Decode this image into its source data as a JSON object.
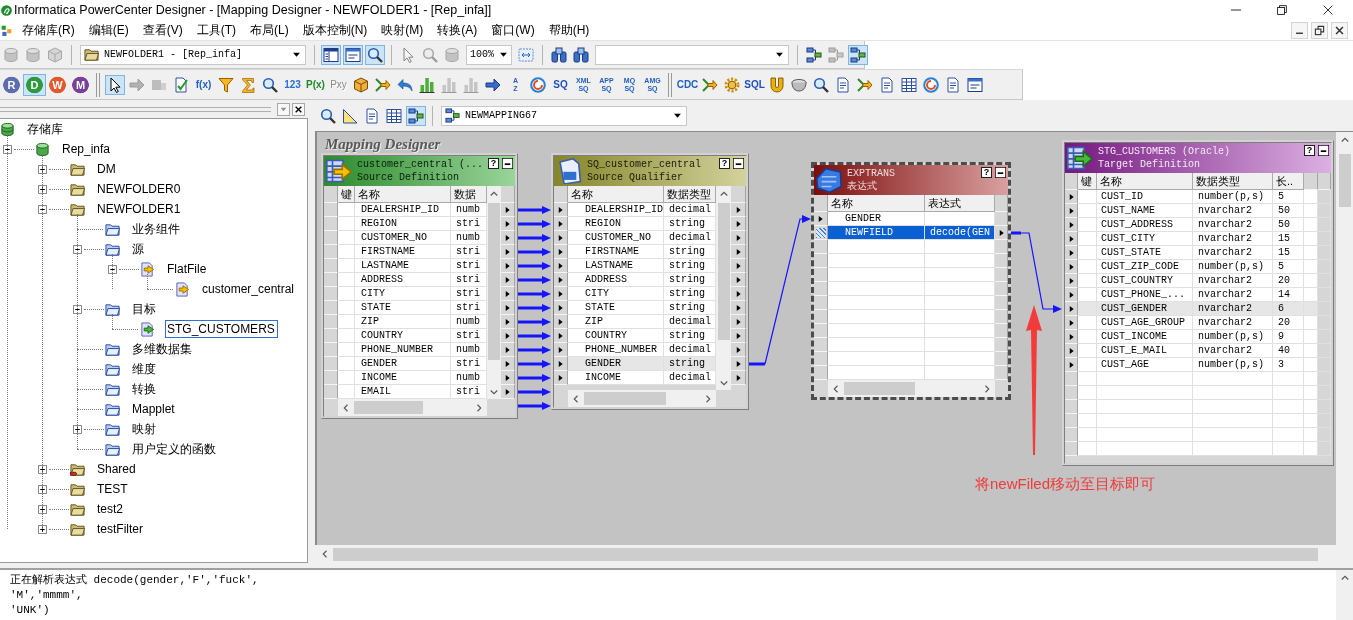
{
  "window": {
    "title": "Informatica PowerCenter Designer - [Mapping Designer - NEWFOLDER1 - [Rep_infa]]"
  },
  "menu": [
    "存储库(R)",
    "编辑(E)",
    "查看(V)",
    "工具(T)",
    "布局(L)",
    "版本控制(N)",
    "映射(M)",
    "转换(A)",
    "窗口(W)",
    "帮助(H)"
  ],
  "toolbar_1": [
    [
      {
        "kind": "cylinder",
        "pressed": false,
        "disabled": true
      },
      {
        "kind": "cylinder",
        "pressed": false,
        "disabled": true
      },
      {
        "kind": "cube",
        "pressed": false,
        "disabled": true
      }
    ],
    [
      {
        "kind": "folder-combo",
        "value": "NEWFOLDER1 - [Rep_infa]"
      }
    ],
    [
      {
        "kind": "panel",
        "pressed": true,
        "disabled": false
      },
      {
        "kind": "window",
        "pressed": true,
        "disabled": false
      },
      {
        "kind": "magnifier",
        "pressed": true,
        "disabled": false
      }
    ],
    [
      {
        "kind": "pointer",
        "pressed": false,
        "disabled": true
      },
      {
        "kind": "magnifier",
        "pressed": false,
        "disabled": true
      },
      {
        "kind": "cylinder",
        "pressed": false,
        "disabled": true
      },
      {
        "kind": "zoom-combo",
        "value": "100%"
      },
      {
        "kind": "fit",
        "pressed": false,
        "disabled": false
      }
    ],
    [
      {
        "kind": "binoculars",
        "pressed": false,
        "disabled": false
      },
      {
        "kind": "binoculars",
        "pressed": false,
        "disabled": false
      },
      {
        "kind": "dropdown"
      }
    ],
    [
      {
        "kind": "flow",
        "pressed": false,
        "disabled": false
      },
      {
        "kind": "flow",
        "pressed": false,
        "disabled": true
      },
      {
        "kind": "flow",
        "pressed": true,
        "disabled": false
      }
    ]
  ],
  "toolbar_2": [
    [
      {
        "kind": "letter",
        "label": "R",
        "color": "#5b6eb0",
        "pressed": false,
        "disabled": false
      },
      {
        "kind": "letter",
        "label": "D",
        "color": "#2f9a3c",
        "pressed": true,
        "disabled": false
      },
      {
        "kind": "letter",
        "label": "W",
        "color": "#e2572b",
        "pressed": false,
        "disabled": false
      },
      {
        "kind": "letter",
        "label": "M",
        "color": "#7a3f96",
        "pressed": false,
        "disabled": false
      }
    ],
    [
      {
        "kind": "pointer",
        "pressed": true,
        "disabled": false
      },
      {
        "kind": "arrow",
        "pressed": false,
        "disabled": true
      },
      {
        "kind": "blocks",
        "pressed": false,
        "disabled": true
      },
      {
        "kind": "check-doc",
        "pressed": false,
        "disabled": false
      },
      {
        "kind": "label",
        "label": "f(x)",
        "color": "#1f5fc8",
        "pressed": false,
        "disabled": false
      },
      {
        "kind": "funnel",
        "pressed": false,
        "disabled": false
      },
      {
        "kind": "sigma",
        "pressed": false,
        "disabled": false
      },
      {
        "kind": "magnifier",
        "pressed": false,
        "disabled": false
      },
      {
        "kind": "label",
        "label": "123",
        "color": "#2a6fd0",
        "pressed": false,
        "disabled": false
      },
      {
        "kind": "label",
        "label": "P(x)",
        "color": "#1d8a2a",
        "pressed": false,
        "disabled": false
      },
      {
        "kind": "label",
        "label": "Pxy",
        "color": "#8a8a8a",
        "pressed": false,
        "disabled": true
      },
      {
        "kind": "cube",
        "pressed": false,
        "disabled": false
      },
      {
        "kind": "merge",
        "pressed": false,
        "disabled": false
      },
      {
        "kind": "curved-arrow",
        "pressed": false,
        "disabled": false
      },
      {
        "kind": "bars",
        "pressed": false,
        "disabled": false
      },
      {
        "kind": "bars",
        "pressed": false,
        "disabled": true
      },
      {
        "kind": "bars",
        "pressed": false,
        "disabled": true
      },
      {
        "kind": "arrow",
        "pressed": false,
        "disabled": false
      },
      {
        "kind": "stacked-label",
        "label": "A Z",
        "color": "#2a5fc0",
        "pressed": false,
        "disabled": false
      },
      {
        "kind": "swirl",
        "pressed": false,
        "disabled": false
      },
      {
        "kind": "label",
        "label": "SQ",
        "color": "#1f4fb8",
        "pressed": false,
        "disabled": false
      },
      {
        "kind": "stacked-label",
        "label": "XML SQ",
        "color": "#1f5fc0",
        "pressed": false,
        "disabled": false
      },
      {
        "kind": "stacked-label",
        "label": "APP SQ",
        "color": "#1f5fc0",
        "pressed": false,
        "disabled": false
      },
      {
        "kind": "stacked-label",
        "label": "MQ SQ",
        "color": "#1f5fc0",
        "pressed": false,
        "disabled": false
      },
      {
        "kind": "stacked-label",
        "label": "AMG SQ",
        "color": "#1f5fc0",
        "pressed": false,
        "disabled": false
      }
    ],
    [
      {
        "kind": "label",
        "label": "CDC",
        "color": "#1f5fc0",
        "pressed": false,
        "disabled": false
      },
      {
        "kind": "merge",
        "pressed": false,
        "disabled": false
      },
      {
        "kind": "gear",
        "pressed": false,
        "disabled": false
      },
      {
        "kind": "label",
        "label": "SQL",
        "color": "#1f4fb8",
        "pressed": false,
        "disabled": false
      },
      {
        "kind": "horseshoe",
        "pressed": false,
        "disabled": false
      },
      {
        "kind": "cup",
        "pressed": false,
        "disabled": false
      },
      {
        "kind": "magnifier",
        "pressed": false,
        "disabled": false
      },
      {
        "kind": "doc",
        "pressed": false,
        "disabled": false
      },
      {
        "kind": "merge",
        "pressed": false,
        "disabled": false
      },
      {
        "kind": "doc",
        "pressed": false,
        "disabled": false
      },
      {
        "kind": "table",
        "pressed": false,
        "disabled": false
      },
      {
        "kind": "swirl",
        "pressed": false,
        "disabled": false
      },
      {
        "kind": "doc",
        "pressed": false,
        "disabled": false
      },
      {
        "kind": "window",
        "pressed": false,
        "disabled": false
      }
    ]
  ],
  "navigator": {
    "tree": [
      {
        "label": "存储库",
        "kind": "repository",
        "selected": false,
        "children": [
          {
            "label": "Rep_infa",
            "kind": "database",
            "expanded": true,
            "selected": false,
            "children": [
              {
                "label": "DM",
                "kind": "folder",
                "expanded": false,
                "selected": false
              },
              {
                "label": "NEWFOLDER0",
                "kind": "folder",
                "expanded": false,
                "selected": false
              },
              {
                "label": "NEWFOLDER1",
                "kind": "folder",
                "expanded": true,
                "selected": false,
                "children": [
                  {
                    "label": "业务组件",
                    "kind": "node-folder",
                    "selected": false
                  },
                  {
                    "label": "源",
                    "kind": "node-folder",
                    "expanded": true,
                    "selected": false,
                    "children": [
                      {
                        "label": "FlatFile",
                        "kind": "source",
                        "expanded": true,
                        "selected": false,
                        "children": [
                          {
                            "label": "customer_central",
                            "kind": "source",
                            "selected": false
                          }
                        ]
                      }
                    ]
                  },
                  {
                    "label": "目标",
                    "kind": "node-folder",
                    "expanded": true,
                    "selected": false,
                    "children": [
                      {
                        "label": "STG_CUSTOMERS",
                        "kind": "target",
                        "selected": true
                      }
                    ]
                  },
                  {
                    "label": "多维数据集",
                    "kind": "node-folder",
                    "selected": false
                  },
                  {
                    "label": "维度",
                    "kind": "node-folder",
                    "selected": false
                  },
                  {
                    "label": "转换",
                    "kind": "node-folder",
                    "selected": false
                  },
                  {
                    "label": "Mapplet",
                    "kind": "node-folder",
                    "selected": false
                  },
                  {
                    "label": "映射",
                    "kind": "node-folder",
                    "expanded": false,
                    "selected": false
                  },
                  {
                    "label": "用户定义的函数",
                    "kind": "node-folder",
                    "selected": false
                  }
                ]
              },
              {
                "label": "Shared",
                "kind": "shared-folder",
                "expanded": false,
                "selected": false
              },
              {
                "label": "TEST",
                "kind": "folder",
                "expanded": false,
                "selected": false
              },
              {
                "label": "test2",
                "kind": "folder",
                "expanded": false,
                "selected": false
              },
              {
                "label": "testFilter",
                "kind": "folder",
                "expanded": false,
                "selected": false
              }
            ]
          }
        ]
      }
    ]
  },
  "workspace": {
    "toolbar": [
      [
        {
          "kind": "magnifier",
          "pressed": false,
          "disabled": false
        },
        {
          "kind": "triangle",
          "pressed": false,
          "disabled": false
        },
        {
          "kind": "doc",
          "pressed": false,
          "disabled": false
        },
        {
          "kind": "table",
          "pressed": false,
          "disabled": false
        },
        {
          "kind": "flow",
          "pressed": true,
          "disabled": false
        }
      ],
      [
        {
          "kind": "mapping-combo",
          "value": "NEWMAPPING67"
        }
      ]
    ],
    "canvas_title": "Mapping Designer",
    "transformations": [
      {
        "kind": "source",
        "title": "customer_central (...",
        "subtitle": "Source Definition",
        "help": "?",
        "selected": false,
        "columns": [
          "键",
          "名称",
          "数据"
        ],
        "rows": [
          {
            "cells": [
              "",
              "DEALERSHIP_ID",
              "numb"
            ],
            "output": true
          },
          {
            "cells": [
              "",
              "REGION",
              "stri"
            ],
            "output": true
          },
          {
            "cells": [
              "",
              "CUSTOMER_NO",
              "numb"
            ],
            "output": true
          },
          {
            "cells": [
              "",
              "FIRSTNAME",
              "stri"
            ],
            "output": true
          },
          {
            "cells": [
              "",
              "LASTNAME",
              "stri"
            ],
            "output": true
          },
          {
            "cells": [
              "",
              "ADDRESS",
              "stri"
            ],
            "output": true
          },
          {
            "cells": [
              "",
              "CITY",
              "stri"
            ],
            "output": true
          },
          {
            "cells": [
              "",
              "STATE",
              "stri"
            ],
            "output": true
          },
          {
            "cells": [
              "",
              "ZIP",
              "numb"
            ],
            "output": true
          },
          {
            "cells": [
              "",
              "COUNTRY",
              "stri"
            ],
            "output": true
          },
          {
            "cells": [
              "",
              "PHONE_NUMBER",
              "numb"
            ],
            "output": true
          },
          {
            "cells": [
              "",
              "GENDER",
              "stri"
            ],
            "output": true
          },
          {
            "cells": [
              "",
              "INCOME",
              "numb"
            ],
            "output": true
          },
          {
            "cells": [
              "",
              "EMAIL",
              "stri"
            ],
            "output": true
          }
        ]
      },
      {
        "kind": "qualifier",
        "title": "SQ_customer_central",
        "subtitle": "Source Qualifier",
        "help": "?",
        "selected": false,
        "columns": [
          "名称",
          "数据类型"
        ],
        "rows": [
          {
            "cells": [
              "DEALERSHIP_ID",
              "decimal"
            ],
            "input": true,
            "output": true,
            "selected": false
          },
          {
            "cells": [
              "REGION",
              "string"
            ],
            "input": true,
            "output": true,
            "selected": false
          },
          {
            "cells": [
              "CUSTOMER_NO",
              "decimal"
            ],
            "input": true,
            "output": true,
            "selected": false
          },
          {
            "cells": [
              "FIRSTNAME",
              "string"
            ],
            "input": true,
            "output": true,
            "selected": false
          },
          {
            "cells": [
              "LASTNAME",
              "string"
            ],
            "input": true,
            "output": true,
            "selected": false
          },
          {
            "cells": [
              "ADDRESS",
              "string"
            ],
            "input": true,
            "output": true,
            "selected": false
          },
          {
            "cells": [
              "CITY",
              "string"
            ],
            "input": true,
            "output": true,
            "selected": false
          },
          {
            "cells": [
              "STATE",
              "string"
            ],
            "input": true,
            "output": true,
            "selected": false
          },
          {
            "cells": [
              "ZIP",
              "decimal"
            ],
            "input": true,
            "output": true,
            "selected": false
          },
          {
            "cells": [
              "COUNTRY",
              "string"
            ],
            "input": true,
            "output": true,
            "selected": false
          },
          {
            "cells": [
              "PHONE_NUMBER",
              "decimal"
            ],
            "input": true,
            "output": true,
            "selected": false
          },
          {
            "cells": [
              "GENDER",
              "string"
            ],
            "input": true,
            "output": true,
            "selected": true
          },
          {
            "cells": [
              "INCOME",
              "decimal"
            ],
            "input": true,
            "output": true,
            "selected": false
          }
        ]
      },
      {
        "kind": "expression",
        "title": "EXPTRANS",
        "subtitle": "表达式",
        "help": "?",
        "selected": true,
        "columns": [
          "名称",
          "表达式"
        ],
        "rows": [
          {
            "cells": [
              "GENDER"
            ],
            "input": true,
            "output": false,
            "selected": false
          },
          {
            "cells": [
              "NEWFIELD",
              "decode(GEN"
            ],
            "input": false,
            "output": true,
            "selected": true
          }
        ]
      },
      {
        "kind": "target",
        "title": "STG_CUSTOMERS (Oracle)",
        "subtitle": "Target Definition",
        "help": "?",
        "selected": false,
        "columns": [
          "键",
          "名称",
          "数据类型",
          "长.."
        ],
        "rows": [
          {
            "cells": [
              "",
              "CUST_ID",
              "number(p,s)",
              "5"
            ],
            "input": true,
            "selected": false
          },
          {
            "cells": [
              "",
              "CUST_NAME",
              "nvarchar2",
              "50"
            ],
            "input": true,
            "selected": false
          },
          {
            "cells": [
              "",
              "CUST_ADDRESS",
              "nvarchar2",
              "50"
            ],
            "input": true,
            "selected": false
          },
          {
            "cells": [
              "",
              "CUST_CITY",
              "nvarchar2",
              "15"
            ],
            "input": true,
            "selected": false
          },
          {
            "cells": [
              "",
              "CUST_STATE",
              "nvarchar2",
              "15"
            ],
            "input": true,
            "selected": false
          },
          {
            "cells": [
              "",
              "CUST_ZIP_CODE",
              "number(p,s)",
              "5"
            ],
            "input": true,
            "selected": false
          },
          {
            "cells": [
              "",
              "CUST_COUNTRY",
              "nvarchar2",
              "20"
            ],
            "input": true,
            "selected": false
          },
          {
            "cells": [
              "",
              "CUST_PHONE_...",
              "nvarchar2",
              "14"
            ],
            "input": true,
            "selected": false
          },
          {
            "cells": [
              "",
              "CUST_GENDER",
              "nvarchar2",
              "6"
            ],
            "input": true,
            "selected": true
          },
          {
            "cells": [
              "",
              "CUST_AGE_GROUP",
              "nvarchar2",
              "20"
            ],
            "input": true,
            "selected": false
          },
          {
            "cells": [
              "",
              "CUST_INCOME",
              "number(p,s)",
              "9"
            ],
            "input": true,
            "selected": false
          },
          {
            "cells": [
              "",
              "CUST_E_MAIL",
              "nvarchar2",
              "40"
            ],
            "input": true,
            "selected": false
          },
          {
            "cells": [
              "",
              "CUST_AGE",
              "number(p,s)",
              "3"
            ],
            "input": true,
            "selected": false
          }
        ]
      }
    ],
    "annotation": "将newFiled移动至目标即可"
  },
  "output": [
    "正在解析表达式 decode(gender,'F','fuck',",
    "'M','mmmm',",
    "'UNK')"
  ]
}
